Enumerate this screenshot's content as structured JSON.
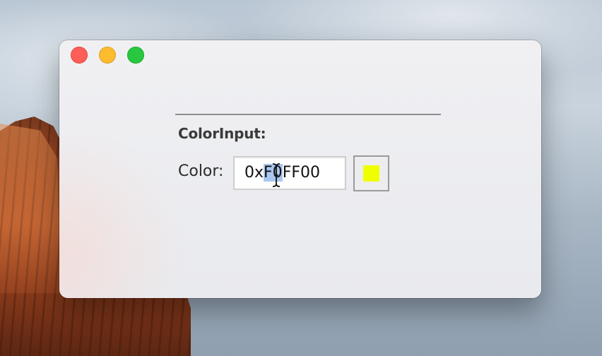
{
  "window": {
    "controls": {
      "close_icon": "close-icon",
      "minimize_icon": "minimize-icon",
      "zoom_icon": "zoom-icon"
    }
  },
  "color_input": {
    "title": "ColorInput:",
    "label": "Color:",
    "value": "0xF0FF00",
    "value_prefix": "0x",
    "value_selected": "F0",
    "value_suffix": "FF00",
    "swatch_color": "#F0FF00"
  },
  "colors": {
    "close": "#fc5f57",
    "minimize": "#fdbc2e",
    "zoom": "#27c840",
    "selection": "#a9c8ef"
  }
}
